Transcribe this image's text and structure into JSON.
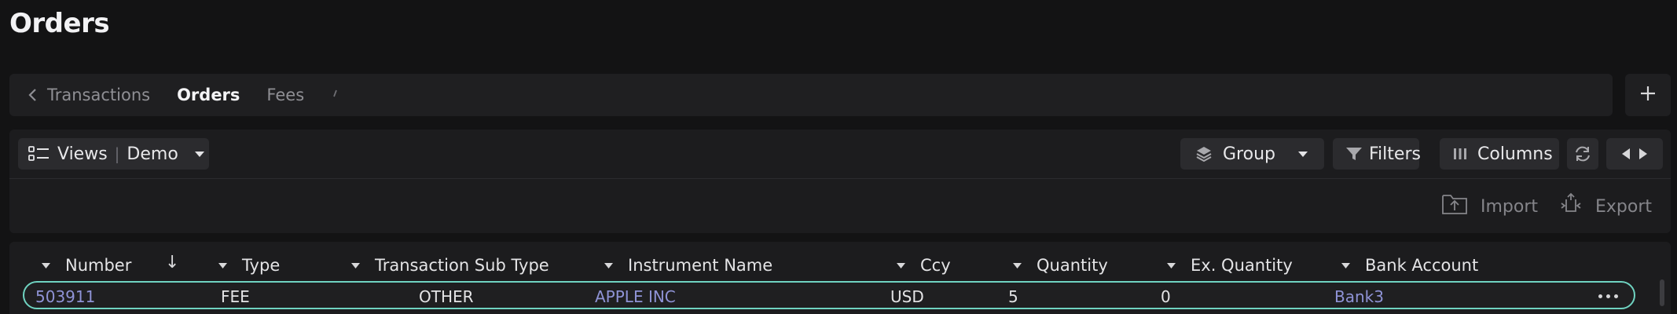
{
  "page": {
    "title": "Orders"
  },
  "tabs": [
    {
      "label": "Transactions",
      "active": false
    },
    {
      "label": "Orders",
      "active": true
    },
    {
      "label": "Fees",
      "active": false
    }
  ],
  "toolbar": {
    "views_label": "Views",
    "view_name": "Demo",
    "group_label": "Group",
    "filters_label": "Filters",
    "columns_label": "Columns",
    "import_label": "Import",
    "export_label": "Export"
  },
  "grid": {
    "columns": [
      "Number",
      "Type",
      "Transaction Sub Type",
      "Instrument Name",
      "Ccy",
      "Quantity",
      "Ex. Quantity",
      "Bank Account"
    ],
    "sort_indicator": "↓",
    "rows": [
      {
        "number": "503911",
        "type": "FEE",
        "sub_type": "OTHER",
        "instrument": "APPLE INC",
        "ccy": "USD",
        "quantity": "5",
        "ex_quantity": "0",
        "bank_account": "Bank3"
      }
    ]
  },
  "colors": {
    "background": "#131314",
    "panel": "#1c1c1e",
    "button": "#2b2b2e",
    "link": "#8f93d6",
    "row_highlight": "#6fd3c1"
  },
  "icons": {
    "back": "chevron-left-icon",
    "add": "plus-icon",
    "views": "list-icon",
    "group": "layers-icon",
    "filters": "filter-icon",
    "columns": "columns-icon",
    "refresh": "refresh-icon",
    "import": "upload-folder-icon",
    "export": "export-arrows-icon",
    "row_menu": "more-horizontal-icon"
  }
}
